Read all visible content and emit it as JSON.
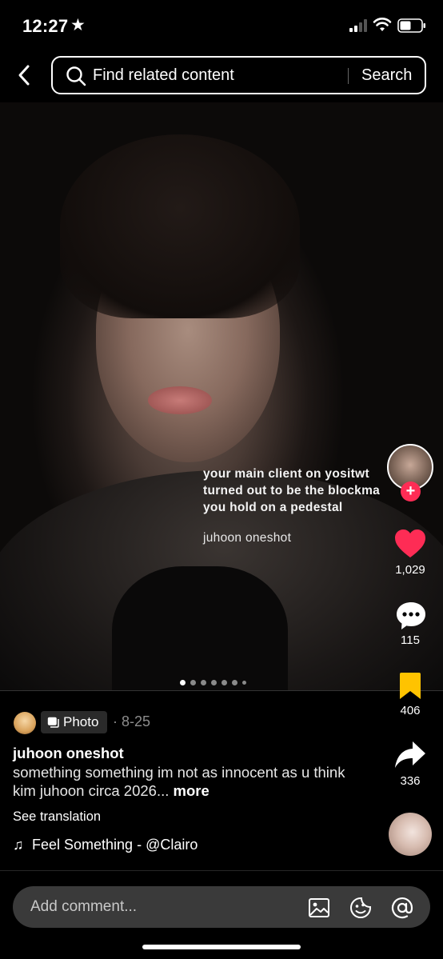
{
  "status_bar": {
    "time": "12:27",
    "star": "★"
  },
  "search": {
    "placeholder": "Find related content",
    "button": "Search"
  },
  "photo": {
    "overlay_lines": [
      "your main client on yositwt",
      "turned out to be the blockma",
      "you hold on a pedestal"
    ],
    "overlay_subtitle": "juhoon oneshot",
    "slides_total": 7,
    "slide_current": 1
  },
  "rail": {
    "likes": "1,029",
    "comments": "115",
    "saves": "406",
    "shares": "336",
    "follow_symbol": "+"
  },
  "caption": {
    "badge": "Photo",
    "date": "· 8-25",
    "title": "juhoon oneshot",
    "description": "something something im not as innocent as u think kim juhoon circa 2026...",
    "more": "more",
    "see_translation": "See translation",
    "music_symbol": "♫",
    "music": "Feel Something - @Clairo"
  },
  "comment_bar": {
    "placeholder": "Add comment..."
  },
  "colors": {
    "like": "#fe2c55",
    "save": "#ffc300",
    "background": "#000000"
  }
}
